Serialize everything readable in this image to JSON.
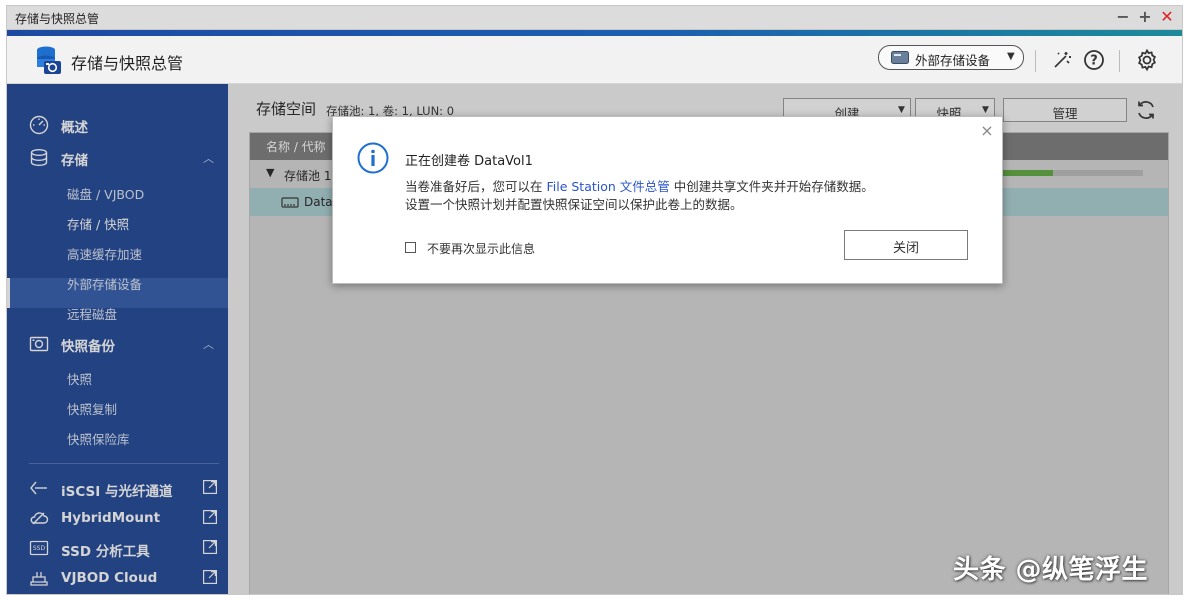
{
  "window": {
    "title": "存储与快照总管"
  },
  "header": {
    "app_title": "存储与快照总管",
    "external_device_button": "外部存储设备"
  },
  "sidebar": {
    "items": [
      {
        "label": "概述",
        "icon": "gauge-icon"
      },
      {
        "label": "存储",
        "icon": "database-icon",
        "expanded": true,
        "children": [
          "磁盘 / VJBOD",
          "存储 / 快照",
          "高速缓存加速",
          "外部存储设备",
          "远程磁盘"
        ]
      },
      {
        "label": "快照备份",
        "icon": "camera-icon",
        "expanded": true,
        "children": [
          "快照",
          "快照复制",
          "快照保险库"
        ]
      }
    ],
    "active_item": "存储 / 快照",
    "external_links": [
      {
        "label": "iSCSI 与光纤通道",
        "icon": "iscsi-icon"
      },
      {
        "label": "HybridMount",
        "icon": "cloud-mount-icon"
      },
      {
        "label": "SSD 分析工具",
        "icon": "ssd-icon"
      },
      {
        "label": "VJBOD Cloud",
        "icon": "vjbod-cloud-icon"
      }
    ]
  },
  "main": {
    "title": "存储空间",
    "meta": "存储池: 1, 卷: 1, LUN: 0",
    "toolbar": {
      "create": "创建",
      "snapshot": "快照",
      "manage": "管理"
    },
    "table": {
      "header_name": "名称 / 代称",
      "rows": [
        {
          "name": "存储池 1",
          "capacity_fraction": 0.36
        },
        {
          "name": "DataV"
        }
      ]
    }
  },
  "dialog": {
    "title": "正在创建卷 DataVol1",
    "body_line1_prefix": "当卷准备好后，您可以在 ",
    "body_line1_link": "File Station 文件总管",
    "body_line1_suffix": " 中创建共享文件夹并开始存储数据。",
    "body_line2": "设置一个快照计划并配置快照保证空间以保护此卷上的数据。",
    "checkbox_label": "不要再次显示此信息",
    "close_button": "关闭"
  },
  "watermark": "头条 @纵笔浮生",
  "colors": {
    "sidebar_bg": "#1c4495",
    "accent": "#2a55c8",
    "selected_row": "#aacfd3",
    "capacity_fill": "#5da83c"
  }
}
